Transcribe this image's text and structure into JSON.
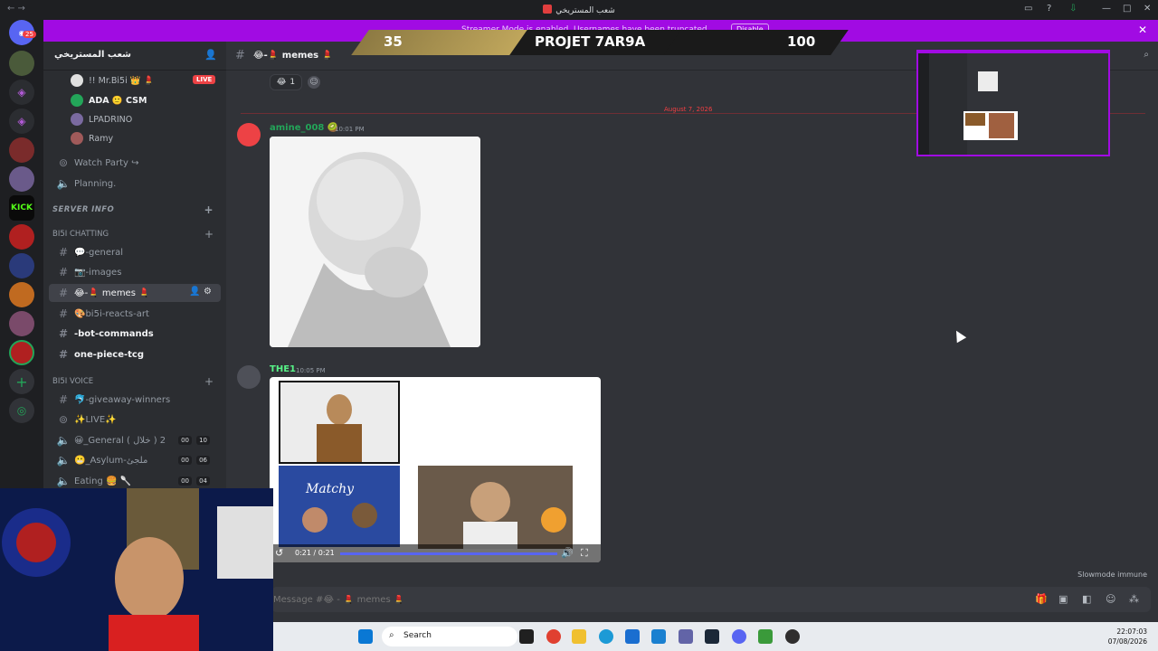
{
  "window": {
    "title": "شعب المستريخي",
    "date_time_time": "22:07:03",
    "date_time_date": "07/08/2026"
  },
  "streamer_banner": {
    "message": "Streamer Mode is enabled. Usernames have been truncated.",
    "disable_label": "Disable"
  },
  "overlay": {
    "left_score": "35",
    "title": "PROJET 7AR9A",
    "right_score": "100"
  },
  "rail": {
    "badge": "25",
    "kick_label": "KICK"
  },
  "server": {
    "name": "شعب المستريخي"
  },
  "voice_users": [
    {
      "name": "!! Mr.Bi5i 👑 💄"
    },
    {
      "name": "ADA 🙂 CSM"
    },
    {
      "name": "LPADRINO"
    },
    {
      "name": "Ramy"
    }
  ],
  "live_label": "LIVE",
  "channels": {
    "watch_party": "Watch Party ↪",
    "planning": "Planning.",
    "server_info": "SERVER INFO",
    "chatting_category": "BI5I CHATTING",
    "general": "💬-general",
    "images": "📷-images",
    "memes": "😂-💄 memes 💄",
    "reacts": "🎨bi5i-reacts-art",
    "bot": "-bot-commands",
    "onepiece": "one-piece-tcg",
    "voice_category": "BI5I VOICE",
    "giveaway": "🐬-giveaway-winners",
    "live": "✨LIVE✨",
    "general_voice": "😀_General ( خلال ) 2",
    "general_voice_cnt_a": "00",
    "general_voice_cnt_b": "10",
    "asylum": "😬_Asylum-ملجئ",
    "asylum_cnt_a": "00",
    "asylum_cnt_b": "06",
    "eating": "Eating 🍔 🥄",
    "eating_cnt_a": "00",
    "eating_cnt_b": "04"
  },
  "header": {
    "channel_name": "😂-💄 memes 💄"
  },
  "reaction": {
    "emoji": "😂",
    "count": "1"
  },
  "divider_date": "August 7, 2026",
  "messages": [
    {
      "author": "amine_008 🥝",
      "time": "10:01 PM",
      "author_color": "#23a559"
    },
    {
      "author": "THE1",
      "time": "10:05 PM",
      "author_color": "#57f287"
    }
  ],
  "video": {
    "time": "0:21 / 0:21"
  },
  "slowmode": "Slowmode immune",
  "composer": {
    "placeholder": "Message #😂 - 💄 memes 💄"
  },
  "taskbar": {
    "search_label": "Search"
  }
}
